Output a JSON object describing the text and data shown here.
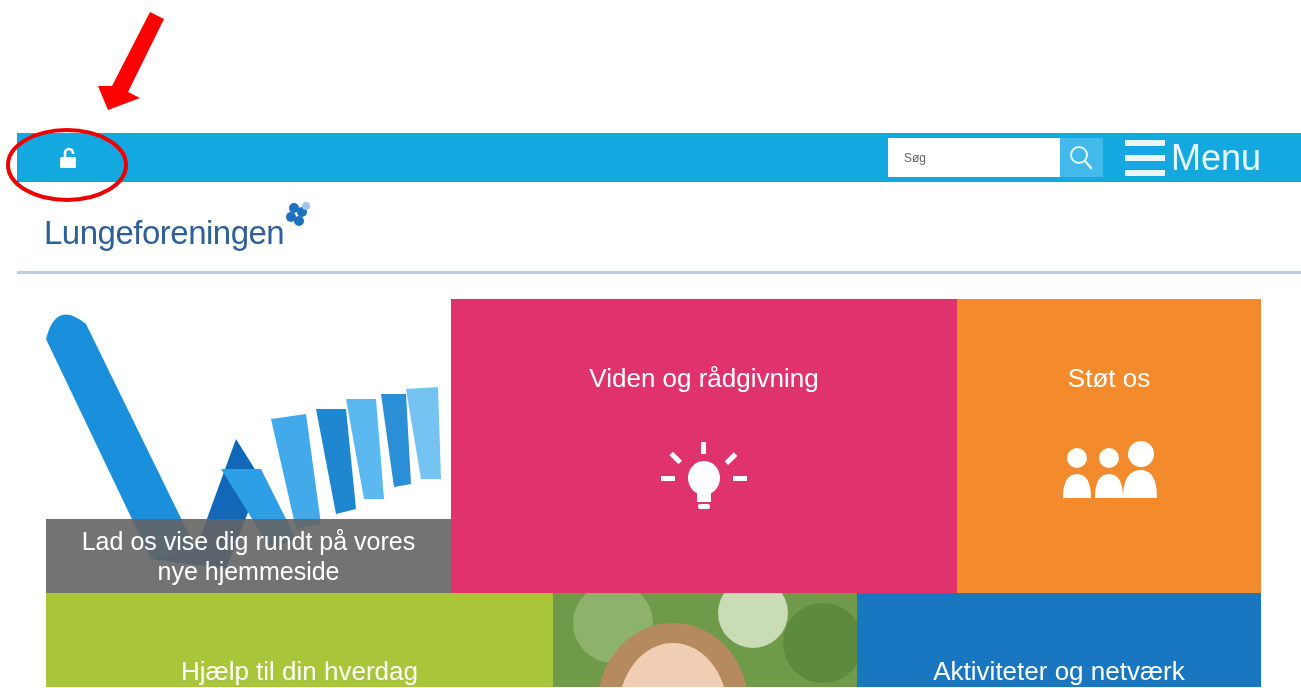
{
  "top_bar": {
    "search": {
      "placeholder": "Søg"
    },
    "menu_label": "Menu"
  },
  "logo": {
    "text": "Lungeforeningen"
  },
  "tiles": [
    {
      "kind": "picture",
      "caption": "Lad os vise dig rundt på vores nye hjemmeside"
    },
    {
      "kind": "color",
      "title": "Viden og rådgivning",
      "color": "#e0336e"
    },
    {
      "kind": "color",
      "title": "Støt os",
      "color": "#f38a2c"
    },
    {
      "kind": "color",
      "title": "Hjælp til din hverdag",
      "color": "#a9c63a"
    },
    {
      "kind": "picture"
    },
    {
      "kind": "color",
      "title": "Aktiviteter og netværk",
      "color": "#1877c0"
    }
  ],
  "annotations": [
    {
      "kind": "arrow"
    },
    {
      "kind": "circle"
    }
  ]
}
